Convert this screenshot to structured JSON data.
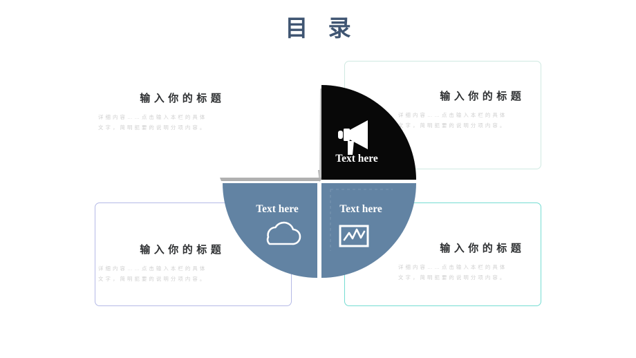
{
  "page": {
    "title": "目 录",
    "background": "#ffffff",
    "title_color": "#3f5572"
  },
  "colors": {
    "slate_blue": "#6283a3",
    "black": "#080808",
    "gray_wedge": "#c2c2c2",
    "gray_wedge_dark": "#a8a8a8",
    "border_mint": "#cfe9e1",
    "border_purple": "#b4b9e6",
    "border_aqua": "#74dcd2",
    "body_text": "#cfcfcf",
    "heading_text": "#2f3133"
  },
  "diagram": {
    "type": "exploded-quadrant-pie",
    "center_label_font": "serif",
    "segments": [
      {
        "id": "top-left",
        "position": "top-left",
        "color": "#c2c2c2",
        "label": "",
        "icon": "none",
        "state": "collapsed"
      },
      {
        "id": "top-right",
        "position": "top-right",
        "color": "#080808",
        "label": "Text here",
        "icon": "megaphone-icon"
      },
      {
        "id": "bottom-left",
        "position": "bottom-left",
        "color": "#6283a3",
        "label": "Text here",
        "icon": "cloud-icon"
      },
      {
        "id": "bottom-right",
        "position": "bottom-right",
        "color": "#6283a3",
        "label": "Text here",
        "icon": "line-chart-icon"
      }
    ]
  },
  "cards": [
    {
      "id": "top-left",
      "heading": "输入你的标题",
      "body_line1": "详细内容……点击输入本栏的具体",
      "body_line2": "文字，简明扼要的说明分项内容。",
      "has_border": false,
      "border_color": ""
    },
    {
      "id": "top-right",
      "heading": "输入你的标题",
      "body_line1": "详细内容……点击输入本栏的具体",
      "body_line2": "文字，简明扼要的说明分项内容。",
      "has_border": true,
      "border_color": "#cfe9e1"
    },
    {
      "id": "bottom-left",
      "heading": "输入你的标题",
      "body_line1": "详细内容……点击输入本栏的具体",
      "body_line2": "文字，简明扼要的说明分项内容。",
      "has_border": true,
      "border_color": "#b4b9e6"
    },
    {
      "id": "bottom-right",
      "heading": "输入你的标题",
      "body_line1": "详细内容……点击输入本栏的具体",
      "body_line2": "文字，简明扼要的说明分项内容。",
      "has_border": true,
      "border_color": "#74dcd2"
    }
  ]
}
